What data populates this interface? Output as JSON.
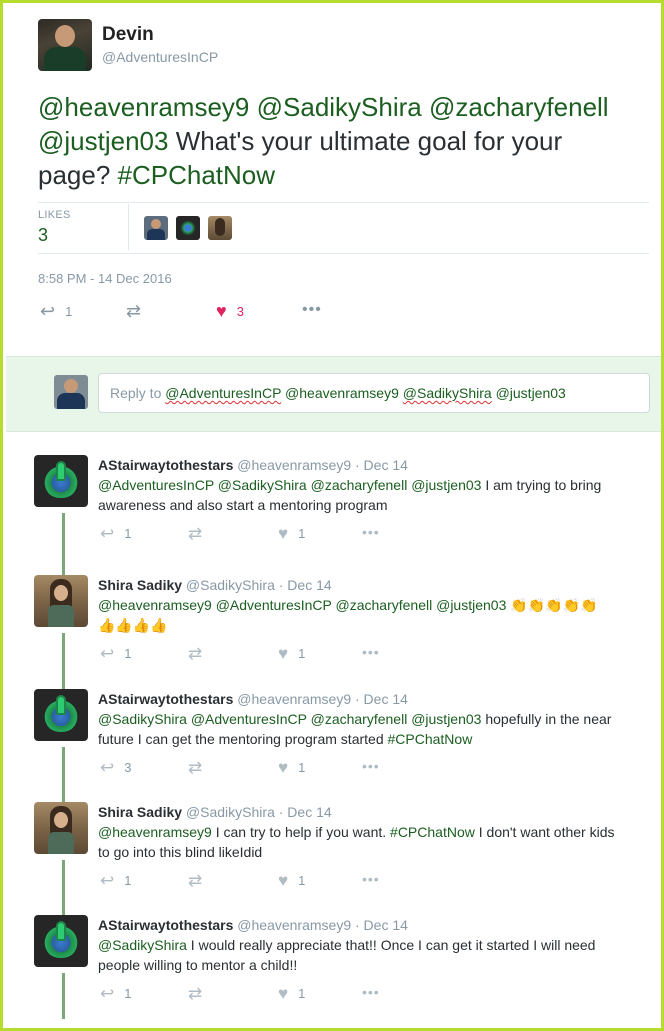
{
  "main_tweet": {
    "author_name": "Devin",
    "author_handle": "@AdventuresInCP",
    "text_parts": [
      {
        "type": "mention",
        "text": "@heavenramsey9"
      },
      {
        "type": "text",
        "text": " "
      },
      {
        "type": "mention",
        "text": "@SadikyShira"
      },
      {
        "type": "text",
        "text": " "
      },
      {
        "type": "mention",
        "text": "@zacharyfenell"
      },
      {
        "type": "text",
        "text": " "
      },
      {
        "type": "mention",
        "text": "@justjen03"
      },
      {
        "type": "text",
        "text": " What's your ultimate goal for your page? "
      },
      {
        "type": "mention",
        "text": "#CPChatNow"
      }
    ],
    "likes_label": "LIKES",
    "likes_count": "3",
    "timestamp": "8:58 PM - 14 Dec 2016",
    "actions": {
      "reply_count": "1",
      "like_count": "3"
    }
  },
  "reply_box": {
    "prefix": "Reply to ",
    "mentions": [
      "@AdventuresInCP",
      "@heavenramsey9",
      "@SadikyShira",
      "@justjen03"
    ]
  },
  "replies": [
    {
      "author_name": "AStairwaytothestars",
      "author_handle": "@heavenramsey9",
      "date": "· Dec 14",
      "line1": [
        {
          "type": "mention",
          "text": "@AdventuresInCP"
        },
        {
          "type": "text",
          "text": " "
        },
        {
          "type": "mention",
          "text": "@SadikyShira"
        },
        {
          "type": "text",
          "text": " "
        },
        {
          "type": "mention",
          "text": "@zacharyfenell"
        },
        {
          "type": "text",
          "text": " "
        },
        {
          "type": "mention",
          "text": "@justjen03"
        },
        {
          "type": "text",
          "text": " I am trying to bring"
        }
      ],
      "line2": [
        {
          "type": "text",
          "text": "awareness and also start a mentoring program"
        }
      ],
      "reply_count": "1",
      "like_count": "1",
      "avatar": "green"
    },
    {
      "author_name": "Shira Sadiky",
      "author_handle": "@SadikyShira",
      "date": "· Dec 14",
      "line1": [
        {
          "type": "mention",
          "text": "@heavenramsey9"
        },
        {
          "type": "text",
          "text": " "
        },
        {
          "type": "mention",
          "text": "@AdventuresInCP"
        },
        {
          "type": "text",
          "text": " "
        },
        {
          "type": "mention",
          "text": "@zacharyfenell"
        },
        {
          "type": "text",
          "text": " "
        },
        {
          "type": "mention",
          "text": "@justjen03"
        },
        {
          "type": "text",
          "text": " "
        },
        {
          "type": "emoji",
          "text": "👏👏👏👏👏"
        }
      ],
      "line2": [
        {
          "type": "emoji",
          "text": "👍👍👍👍"
        }
      ],
      "reply_count": "1",
      "like_count": "1",
      "avatar": "shira"
    },
    {
      "author_name": "AStairwaytothestars",
      "author_handle": "@heavenramsey9",
      "date": "· Dec 14",
      "line1": [
        {
          "type": "mention",
          "text": "@SadikyShira"
        },
        {
          "type": "text",
          "text": " "
        },
        {
          "type": "mention",
          "text": "@AdventuresInCP"
        },
        {
          "type": "text",
          "text": " "
        },
        {
          "type": "mention",
          "text": "@zacharyfenell"
        },
        {
          "type": "text",
          "text": " "
        },
        {
          "type": "mention",
          "text": "@justjen03"
        },
        {
          "type": "text",
          "text": " hopefully in the near"
        }
      ],
      "line2": [
        {
          "type": "text",
          "text": "future I can get the mentoring program started "
        },
        {
          "type": "mention",
          "text": "#CPChatNow"
        }
      ],
      "reply_count": "3",
      "like_count": "1",
      "avatar": "green"
    },
    {
      "author_name": "Shira Sadiky",
      "author_handle": "@SadikyShira",
      "date": "· Dec 14",
      "line1": [
        {
          "type": "mention",
          "text": "@heavenramsey9"
        },
        {
          "type": "text",
          "text": "  I can try to help if you want. "
        },
        {
          "type": "mention",
          "text": "#CPChatNow"
        },
        {
          "type": "text",
          "text": " I don't want other kids"
        }
      ],
      "line2": [
        {
          "type": "text",
          "text": "to go into this blind likeIdid"
        }
      ],
      "reply_count": "1",
      "like_count": "1",
      "avatar": "shira"
    },
    {
      "author_name": "AStairwaytothestars",
      "author_handle": "@heavenramsey9",
      "date": "· Dec 14",
      "line1": [
        {
          "type": "mention",
          "text": "@SadikyShira"
        },
        {
          "type": "text",
          "text": " I would really appreciate that!! Once I can get it started I will need"
        }
      ],
      "line2": [
        {
          "type": "text",
          "text": "people willing to mentor a child!!"
        }
      ],
      "reply_count": "1",
      "like_count": "1",
      "avatar": "green"
    }
  ],
  "icons": {
    "reply": "reply-icon",
    "retweet": "retweet-icon",
    "like": "heart-icon",
    "more": "more-icon"
  },
  "colors": {
    "border": "#b5dc2f",
    "mention": "#1b5e20",
    "reply_area_bg": "#e8f5e9",
    "liked_heart": "#e0245e"
  }
}
